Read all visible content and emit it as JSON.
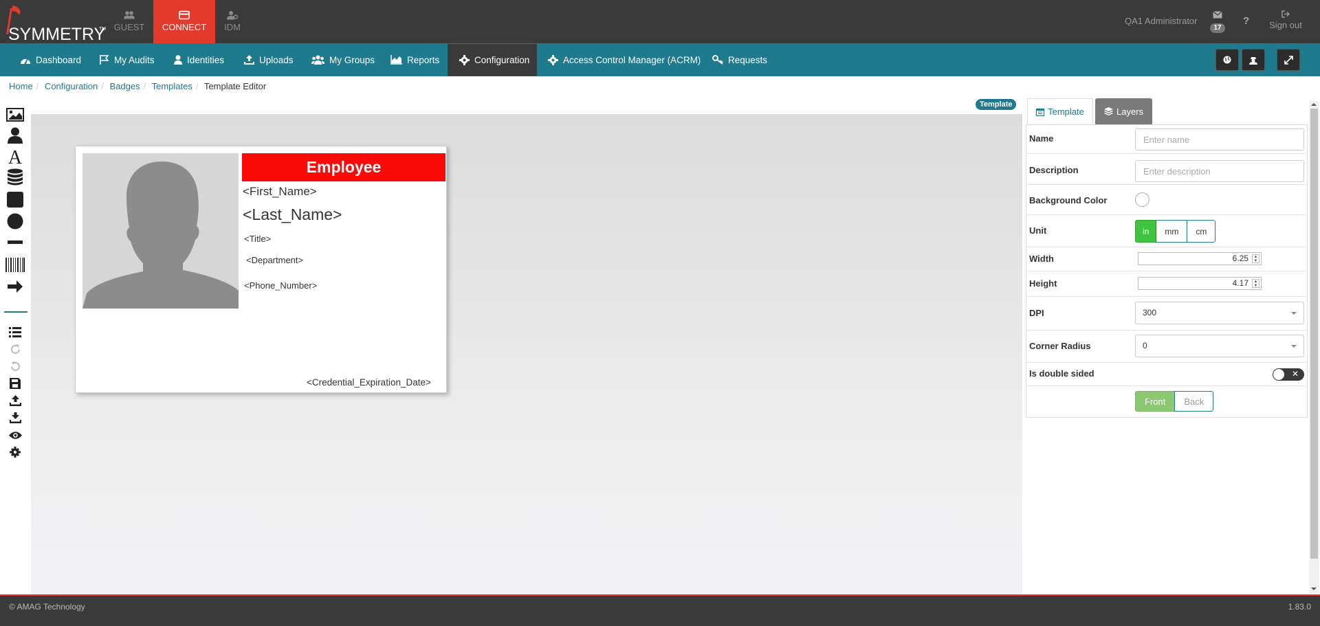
{
  "app": {
    "logo_text": "SYMMETRY",
    "logo_tm": "TM",
    "tabs": [
      {
        "label": "GUEST",
        "icon": "users-icon"
      },
      {
        "label": "CONNECT",
        "icon": "card-icon"
      },
      {
        "label": "IDM",
        "icon": "user-gear-icon"
      }
    ],
    "user": "QA1 Administrator",
    "mail_count": "17",
    "help": "?",
    "signout": "Sign out"
  },
  "nav": {
    "items": [
      {
        "label": "Dashboard",
        "icon": "dashboard-icon"
      },
      {
        "label": "My Audits",
        "icon": "flag-icon"
      },
      {
        "label": "Identities",
        "icon": "user-icon"
      },
      {
        "label": "Uploads",
        "icon": "upload-icon"
      },
      {
        "label": "My Groups",
        "icon": "users-icon"
      },
      {
        "label": "Reports",
        "icon": "area-chart-icon"
      },
      {
        "label": "Configuration",
        "icon": "gear-icon"
      },
      {
        "label": "Access Control Manager (ACRM)",
        "icon": "gear-icon"
      },
      {
        "label": "Requests",
        "icon": "key-icon"
      }
    ]
  },
  "breadcrumb": [
    "Home",
    "Configuration",
    "Badges",
    "Templates",
    "Template Editor"
  ],
  "canvas": {
    "badge_label": "Template",
    "card": {
      "banner": "Employee",
      "first_name": "<First_Name>",
      "last_name": "<Last_Name>",
      "title": "<Title>",
      "department": "<Department>",
      "phone": "<Phone_Number>",
      "expiration": "<Credential_Expiration_Date>"
    }
  },
  "panel": {
    "tabs": {
      "template": "Template",
      "layers": "Layers"
    },
    "name": {
      "label": "Name",
      "placeholder": "Enter name"
    },
    "description": {
      "label": "Description",
      "placeholder": "Enter description"
    },
    "background_color": {
      "label": "Background Color"
    },
    "unit": {
      "label": "Unit",
      "options": [
        "in",
        "mm",
        "cm"
      ],
      "selected": "in"
    },
    "width": {
      "label": "Width",
      "value": "6.25"
    },
    "height": {
      "label": "Height",
      "value": "4.17"
    },
    "dpi": {
      "label": "DPI",
      "value": "300"
    },
    "corner_radius": {
      "label": "Corner Radius",
      "value": "0"
    },
    "double_sided": {
      "label": "Is double sided",
      "value": false
    },
    "side": {
      "options": [
        "Front",
        "Back"
      ],
      "selected": "Front"
    }
  },
  "footer": {
    "copyright": "© AMAG Technology",
    "version": "1.83.0"
  },
  "colors": {
    "topbar": "#3a3a3a",
    "accent_red": "#e23b2e",
    "nav_teal": "#1e7a8c",
    "banner_red": "#fb0a0a",
    "unit_green": "#3ec43e",
    "side_green": "#8cc870"
  }
}
